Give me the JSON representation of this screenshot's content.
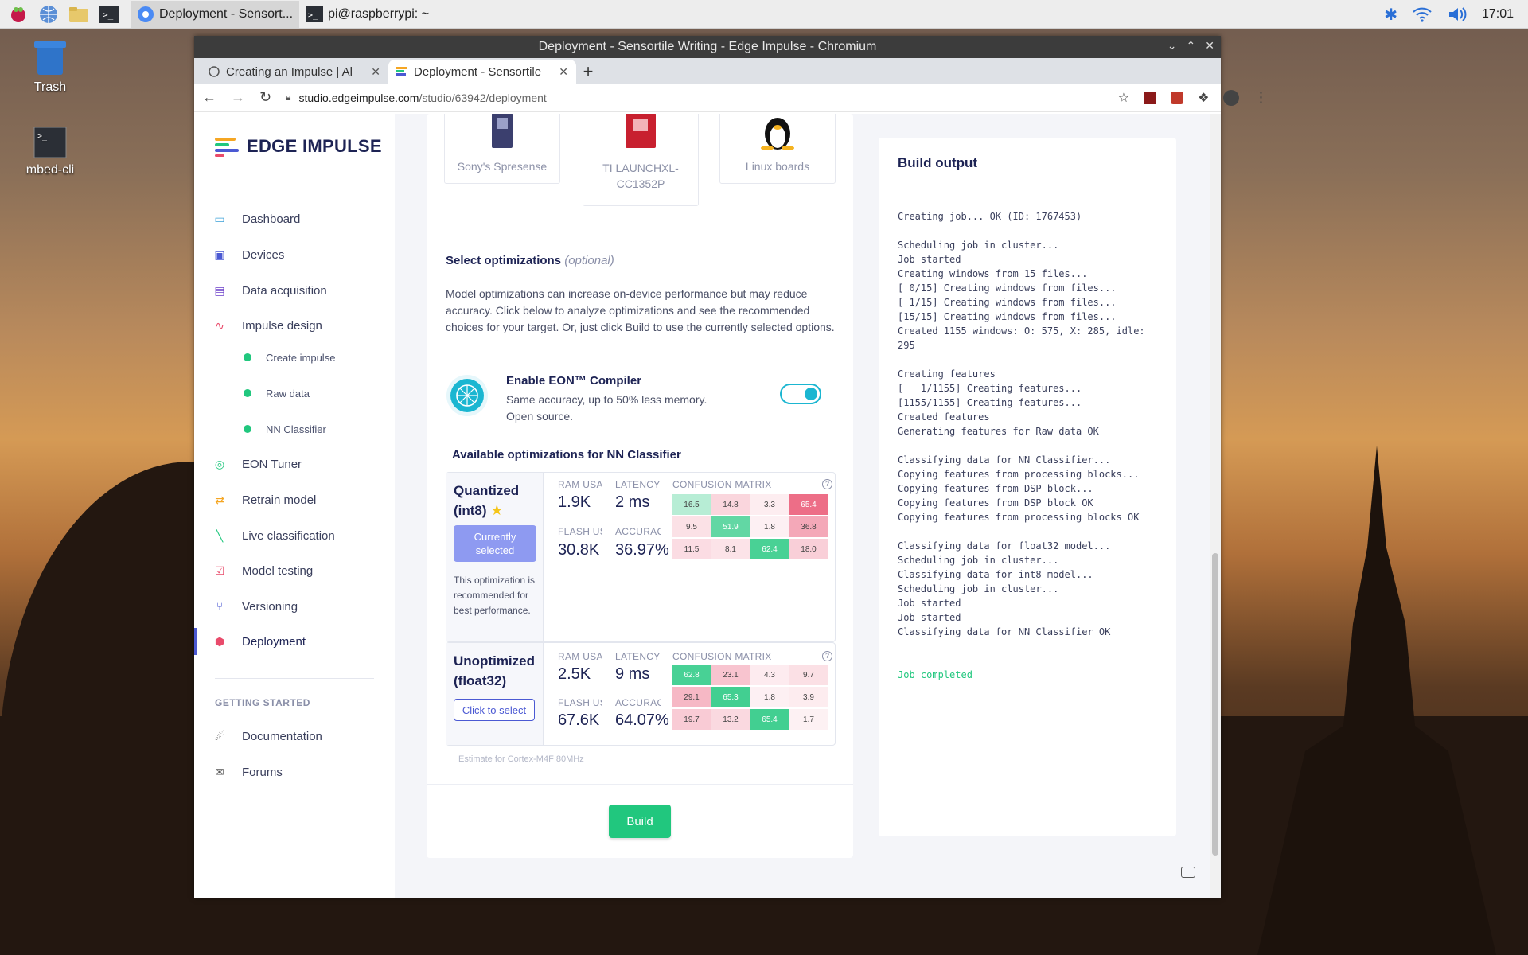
{
  "taskbar": {
    "tasks": [
      "Deployment - Sensort...",
      "pi@raspberrypi: ~"
    ],
    "clock": "17:01"
  },
  "desktop": {
    "icons": [
      "Trash",
      "mbed-cli"
    ]
  },
  "browser": {
    "window_title": "Deployment - Sensortile Writing - Edge Impulse - Chromium",
    "tabs": [
      "Creating an Impulse | Al",
      "Deployment - Sensortile"
    ],
    "url_domain": "studio.edgeimpulse.com",
    "url_path": "/studio/63942/deployment"
  },
  "sidebar": {
    "logo": "EDGE IMPULSE",
    "items": [
      "Dashboard",
      "Devices",
      "Data acquisition",
      "Impulse design",
      "EON Tuner",
      "Retrain model",
      "Live classification",
      "Model testing",
      "Versioning",
      "Deployment"
    ],
    "subitems": [
      "Create impulse",
      "Raw data",
      "NN Classifier"
    ],
    "section": "GETTING STARTED",
    "help": [
      "Documentation",
      "Forums"
    ]
  },
  "boards": [
    "Sony's Spresense",
    "TI LAUNCHXL-CC1352P",
    "Linux boards"
  ],
  "optimizations": {
    "title": "Select optimizations",
    "optional": "(optional)",
    "description": "Model optimizations can increase on-device performance but may reduce accuracy. Click below to analyze optimizations and see the recommended choices for your target. Or, just click Build to use the currently selected options.",
    "eon_title": "Enable EON™ Compiler",
    "eon_desc": "Same accuracy, up to 50% less memory. Open source.",
    "eon_enabled": true,
    "available_title": "Available optimizations for NN Classifier",
    "labels": {
      "ram": "RAM USAGE",
      "latency": "LATENCY",
      "flash": "FLASH USAGE",
      "accuracy": "ACCURACY",
      "cm": "CONFUSION MATRIX"
    },
    "quantized": {
      "name_line1": "Quantized",
      "name_line2": "(int8)",
      "button": "Currently selected",
      "note": "This optimization is recommended for best performance.",
      "ram": "1.9K",
      "latency": "2 ms",
      "flash": "30.8K",
      "accuracy": "36.97%",
      "cm": [
        [
          "16.5",
          "14.8",
          "3.3",
          "65.4"
        ],
        [
          "9.5",
          "51.9",
          "1.8",
          "36.8"
        ],
        [
          "11.5",
          "8.1",
          "62.4",
          "18.0"
        ]
      ]
    },
    "unoptimized": {
      "name_line1": "Unoptimized",
      "name_line2": "(float32)",
      "button": "Click to select",
      "ram": "2.5K",
      "latency": "9 ms",
      "flash": "67.6K",
      "accuracy": "64.07%",
      "cm": [
        [
          "62.8",
          "23.1",
          "4.3",
          "9.7"
        ],
        [
          "29.1",
          "65.3",
          "1.8",
          "3.9"
        ],
        [
          "19.7",
          "13.2",
          "65.4",
          "1.7"
        ]
      ]
    },
    "estimate": "Estimate for Cortex-M4F 80MHz",
    "build": "Build"
  },
  "build_output": {
    "title": "Build output",
    "lines": [
      "Creating job... OK (ID: 1767453)",
      "",
      "Scheduling job in cluster...",
      "Job started",
      "Creating windows from 15 files...",
      "[ 0/15] Creating windows from files...",
      "[ 1/15] Creating windows from files...",
      "[15/15] Creating windows from files...",
      "Created 1155 windows: O: 575, X: 285, idle:",
      "295",
      "",
      "Creating features",
      "[   1/1155] Creating features...",
      "[1155/1155] Creating features...",
      "Created features",
      "Generating features for Raw data OK",
      "",
      "Classifying data for NN Classifier...",
      "Copying features from processing blocks...",
      "Copying features from DSP block...",
      "Copying features from DSP block OK",
      "Copying features from processing blocks OK",
      "",
      "Classifying data for float32 model...",
      "Scheduling job in cluster...",
      "Classifying data for int8 model...",
      "Scheduling job in cluster...",
      "Job started",
      "Job started",
      "Classifying data for NN Classifier OK",
      "",
      "",
      "Job completed"
    ]
  }
}
